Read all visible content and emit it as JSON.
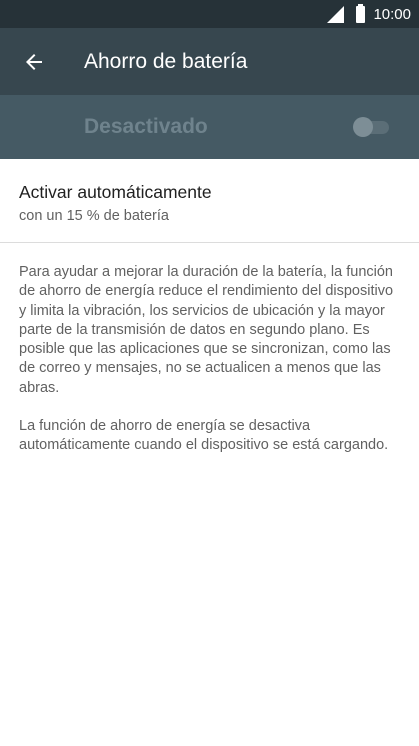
{
  "status_bar": {
    "time": "10:00"
  },
  "toolbar": {
    "title": "Ahorro de batería"
  },
  "master_switch": {
    "label": "Desactivado",
    "enabled": false
  },
  "preference": {
    "title": "Activar automáticamente",
    "summary": "con un 15 % de batería"
  },
  "footer": {
    "paragraph_1": "Para ayudar a mejorar la duración de la batería, la función de ahorro de energía reduce el rendimiento del dispositivo y limita la vibración, los servicios de ubicación y la mayor parte de la transmisión de datos en segundo plano. Es posible que las aplicaciones que se sincronizan, como las de correo y mensajes, no se actualicen a menos que las abras.",
    "paragraph_2": "La función de ahorro de energía se desactiva automáticamente cuando el dispositivo se está cargando."
  },
  "colors": {
    "status_bar": "#263238",
    "toolbar": "#37474f",
    "switch_bar": "#455a64"
  },
  "icons": {
    "signal": "signal-icon",
    "battery": "battery-icon",
    "back": "arrow-back-icon"
  }
}
